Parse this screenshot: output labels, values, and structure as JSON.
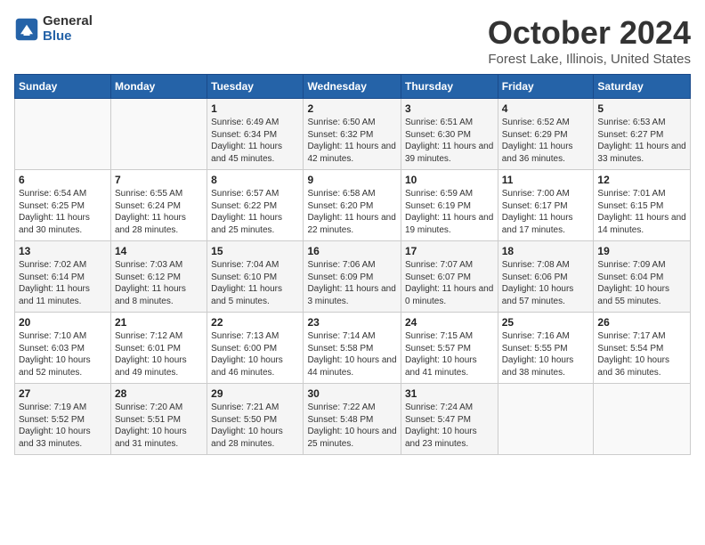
{
  "logo": {
    "general": "General",
    "blue": "Blue"
  },
  "header": {
    "month": "October 2024",
    "location": "Forest Lake, Illinois, United States"
  },
  "weekdays": [
    "Sunday",
    "Monday",
    "Tuesday",
    "Wednesday",
    "Thursday",
    "Friday",
    "Saturday"
  ],
  "weeks": [
    [
      {
        "day": "",
        "info": ""
      },
      {
        "day": "",
        "info": ""
      },
      {
        "day": "1",
        "info": "Sunrise: 6:49 AM\nSunset: 6:34 PM\nDaylight: 11 hours and 45 minutes."
      },
      {
        "day": "2",
        "info": "Sunrise: 6:50 AM\nSunset: 6:32 PM\nDaylight: 11 hours and 42 minutes."
      },
      {
        "day": "3",
        "info": "Sunrise: 6:51 AM\nSunset: 6:30 PM\nDaylight: 11 hours and 39 minutes."
      },
      {
        "day": "4",
        "info": "Sunrise: 6:52 AM\nSunset: 6:29 PM\nDaylight: 11 hours and 36 minutes."
      },
      {
        "day": "5",
        "info": "Sunrise: 6:53 AM\nSunset: 6:27 PM\nDaylight: 11 hours and 33 minutes."
      }
    ],
    [
      {
        "day": "6",
        "info": "Sunrise: 6:54 AM\nSunset: 6:25 PM\nDaylight: 11 hours and 30 minutes."
      },
      {
        "day": "7",
        "info": "Sunrise: 6:55 AM\nSunset: 6:24 PM\nDaylight: 11 hours and 28 minutes."
      },
      {
        "day": "8",
        "info": "Sunrise: 6:57 AM\nSunset: 6:22 PM\nDaylight: 11 hours and 25 minutes."
      },
      {
        "day": "9",
        "info": "Sunrise: 6:58 AM\nSunset: 6:20 PM\nDaylight: 11 hours and 22 minutes."
      },
      {
        "day": "10",
        "info": "Sunrise: 6:59 AM\nSunset: 6:19 PM\nDaylight: 11 hours and 19 minutes."
      },
      {
        "day": "11",
        "info": "Sunrise: 7:00 AM\nSunset: 6:17 PM\nDaylight: 11 hours and 17 minutes."
      },
      {
        "day": "12",
        "info": "Sunrise: 7:01 AM\nSunset: 6:15 PM\nDaylight: 11 hours and 14 minutes."
      }
    ],
    [
      {
        "day": "13",
        "info": "Sunrise: 7:02 AM\nSunset: 6:14 PM\nDaylight: 11 hours and 11 minutes."
      },
      {
        "day": "14",
        "info": "Sunrise: 7:03 AM\nSunset: 6:12 PM\nDaylight: 11 hours and 8 minutes."
      },
      {
        "day": "15",
        "info": "Sunrise: 7:04 AM\nSunset: 6:10 PM\nDaylight: 11 hours and 5 minutes."
      },
      {
        "day": "16",
        "info": "Sunrise: 7:06 AM\nSunset: 6:09 PM\nDaylight: 11 hours and 3 minutes."
      },
      {
        "day": "17",
        "info": "Sunrise: 7:07 AM\nSunset: 6:07 PM\nDaylight: 11 hours and 0 minutes."
      },
      {
        "day": "18",
        "info": "Sunrise: 7:08 AM\nSunset: 6:06 PM\nDaylight: 10 hours and 57 minutes."
      },
      {
        "day": "19",
        "info": "Sunrise: 7:09 AM\nSunset: 6:04 PM\nDaylight: 10 hours and 55 minutes."
      }
    ],
    [
      {
        "day": "20",
        "info": "Sunrise: 7:10 AM\nSunset: 6:03 PM\nDaylight: 10 hours and 52 minutes."
      },
      {
        "day": "21",
        "info": "Sunrise: 7:12 AM\nSunset: 6:01 PM\nDaylight: 10 hours and 49 minutes."
      },
      {
        "day": "22",
        "info": "Sunrise: 7:13 AM\nSunset: 6:00 PM\nDaylight: 10 hours and 46 minutes."
      },
      {
        "day": "23",
        "info": "Sunrise: 7:14 AM\nSunset: 5:58 PM\nDaylight: 10 hours and 44 minutes."
      },
      {
        "day": "24",
        "info": "Sunrise: 7:15 AM\nSunset: 5:57 PM\nDaylight: 10 hours and 41 minutes."
      },
      {
        "day": "25",
        "info": "Sunrise: 7:16 AM\nSunset: 5:55 PM\nDaylight: 10 hours and 38 minutes."
      },
      {
        "day": "26",
        "info": "Sunrise: 7:17 AM\nSunset: 5:54 PM\nDaylight: 10 hours and 36 minutes."
      }
    ],
    [
      {
        "day": "27",
        "info": "Sunrise: 7:19 AM\nSunset: 5:52 PM\nDaylight: 10 hours and 33 minutes."
      },
      {
        "day": "28",
        "info": "Sunrise: 7:20 AM\nSunset: 5:51 PM\nDaylight: 10 hours and 31 minutes."
      },
      {
        "day": "29",
        "info": "Sunrise: 7:21 AM\nSunset: 5:50 PM\nDaylight: 10 hours and 28 minutes."
      },
      {
        "day": "30",
        "info": "Sunrise: 7:22 AM\nSunset: 5:48 PM\nDaylight: 10 hours and 25 minutes."
      },
      {
        "day": "31",
        "info": "Sunrise: 7:24 AM\nSunset: 5:47 PM\nDaylight: 10 hours and 23 minutes."
      },
      {
        "day": "",
        "info": ""
      },
      {
        "day": "",
        "info": ""
      }
    ]
  ]
}
